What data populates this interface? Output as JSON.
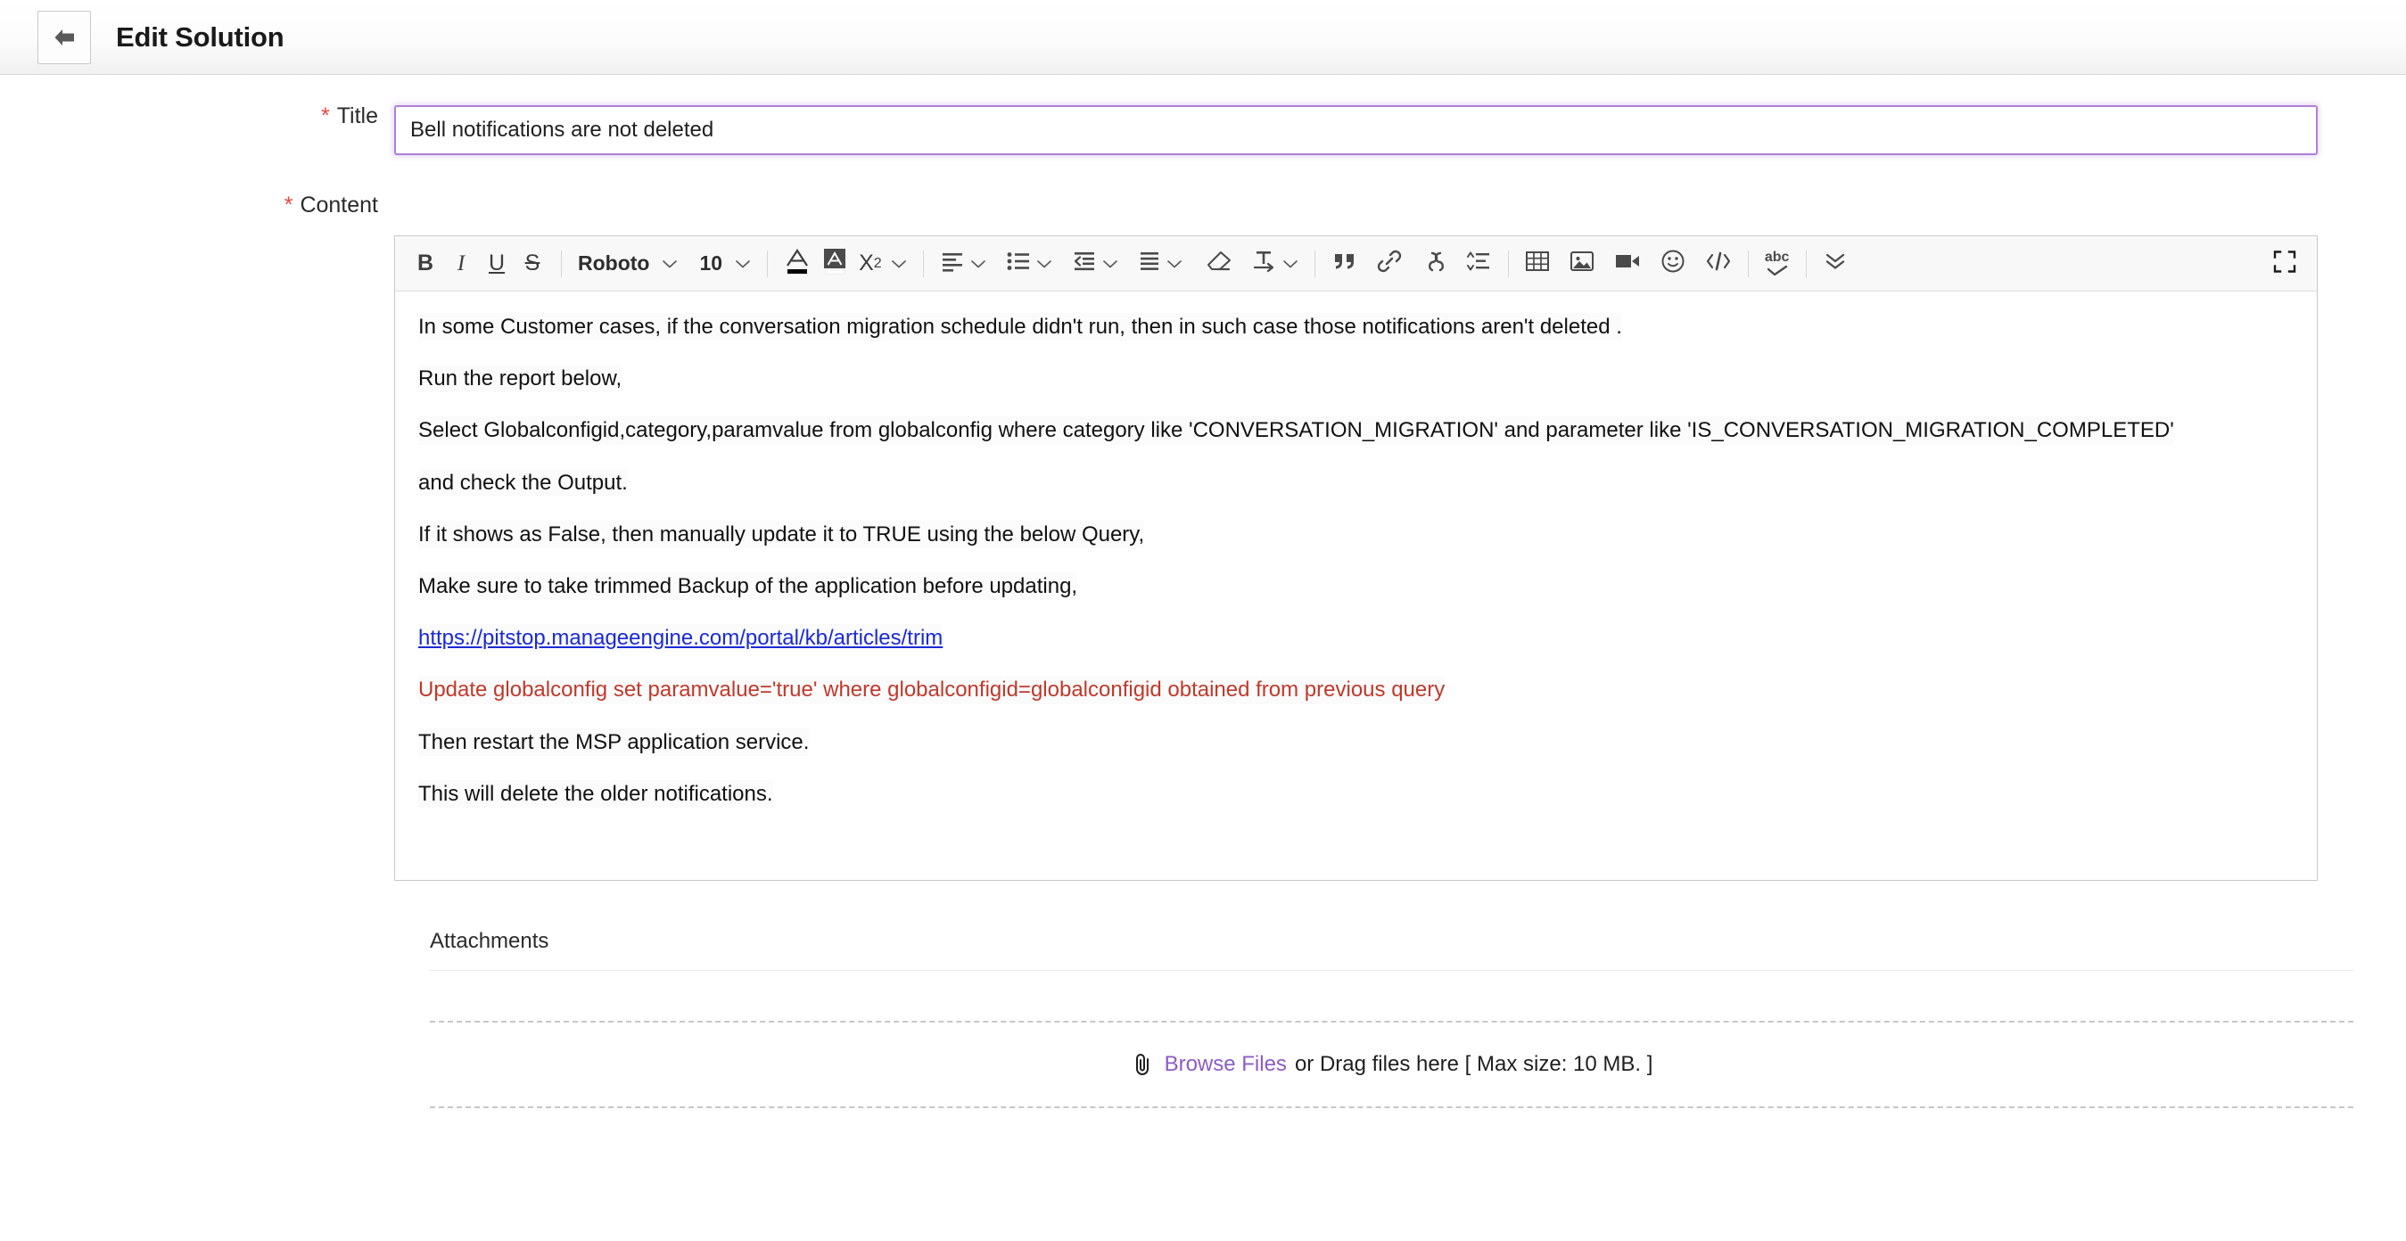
{
  "header": {
    "back_icon": "arrow-left-icon",
    "title": "Edit Solution"
  },
  "form": {
    "title_field": {
      "label": "Title",
      "required_marker": "*",
      "value": "Bell notifications are not deleted",
      "placeholder": "Title",
      "border_color": "#b07fd8"
    },
    "content_field": {
      "label": "Content",
      "required_marker": "*"
    }
  },
  "toolbar": {
    "bold": "B",
    "italic": "I",
    "underline": "U",
    "strikethrough": "S",
    "font_family": "Roboto",
    "font_size": "10",
    "icons": [
      "text-color-icon",
      "highlight-color-icon",
      "superscript-icon",
      "align-icon",
      "bullet-list-icon",
      "outdent-icon",
      "indent-icon",
      "clear-format-icon",
      "text-direction-icon",
      "blockquote-icon",
      "link-icon",
      "unlink-icon",
      "line-height-icon",
      "table-icon",
      "image-icon",
      "video-icon",
      "emoji-icon",
      "code-view-icon",
      "spellcheck-icon",
      "more-options-icon",
      "fullscreen-icon"
    ],
    "superscript_label": "X",
    "superscript_exp": "2",
    "spellcheck_label": "abc"
  },
  "content": {
    "paragraphs": [
      {
        "text": "In some Customer cases, if the conversation migration schedule didn't run, then in such case those notifications aren't deleted .",
        "style": "normal"
      },
      {
        "text": "Run the report below,",
        "style": "normal"
      },
      {
        "text": "Select Globalconfigid,category,paramvalue from globalconfig where category like 'CONVERSATION_MIGRATION' and parameter like 'IS_CONVERSATION_MIGRATION_COMPLETED'",
        "style": "normal"
      },
      {
        "text": "and check the Output.",
        "style": "normal"
      },
      {
        "text": "If it shows as False, then manually update it to TRUE using the below Query,",
        "style": "normal"
      },
      {
        "text": "Make sure to take trimmed Backup of the application before updating,",
        "style": "normal"
      },
      {
        "text": "https://pitstop.manageengine.com/portal/kb/articles/trim",
        "style": "link"
      },
      {
        "text": "Update globalconfig set paramvalue='true' where globalconfigid=globalconfigid obtained from previous query",
        "style": "red"
      },
      {
        "text": "Then restart the MSP application service.",
        "style": "normal"
      },
      {
        "text": "This will delete the older notifications.",
        "style": "normal"
      }
    ],
    "link_color": "#1a2ad6",
    "red_color": "#c0392b"
  },
  "attachments": {
    "label": "Attachments",
    "clip_icon": "paperclip-icon",
    "browse_label": "Browse Files",
    "drag_text": "or Drag files here [ Max size: 10 MB. ]",
    "browse_color": "#8b5cc7"
  }
}
